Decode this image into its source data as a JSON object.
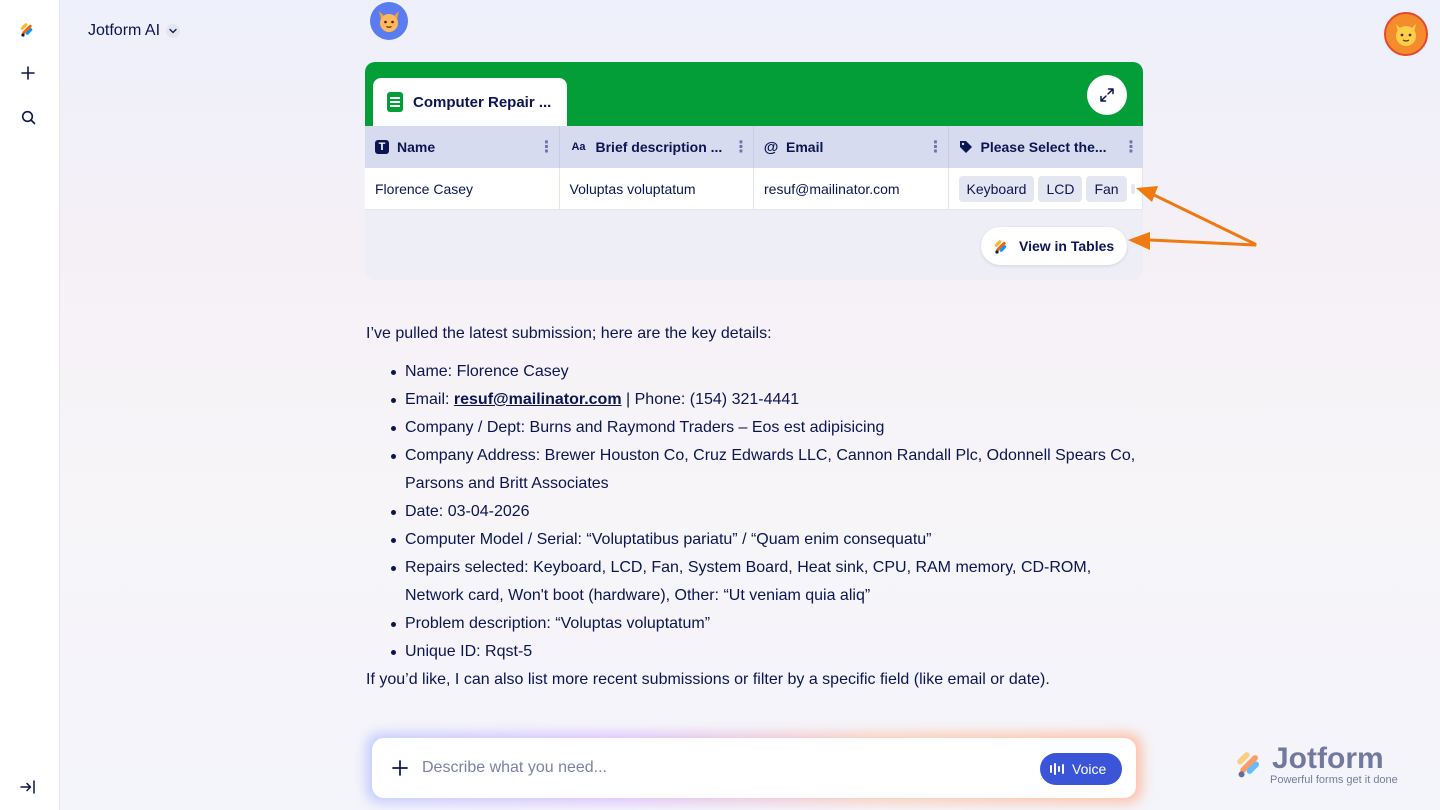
{
  "app": {
    "title": "Jotform AI"
  },
  "card": {
    "tab_title": "Computer Repair ...",
    "columns": [
      {
        "label": "Name",
        "icon": "text-type-icon"
      },
      {
        "label": "Brief description ...",
        "icon": "font-type-icon"
      },
      {
        "label": "Email",
        "icon": "at-icon"
      },
      {
        "label": "Please Select the...",
        "icon": "tag-icon"
      }
    ],
    "row": {
      "name": "Florence Casey",
      "description": "Voluptas voluptatum",
      "email": "resuf@mailinator.com",
      "chips": [
        "Keyboard",
        "LCD",
        "Fan"
      ]
    },
    "view_button": "View in Tables"
  },
  "message": {
    "intro": "I’ve pulled the latest submission; here are the key details:",
    "items": [
      {
        "label": "Name:",
        "text": "Florence Casey"
      },
      {
        "label": "Email:",
        "link": "resuf@mailinator.com",
        "text": "| Phone: (154) 321-4441"
      },
      {
        "label": "Company / Dept:",
        "text": "Burns and Raymond Traders – Eos est adipisicing"
      },
      {
        "label": "Company Address:",
        "text": "Brewer Houston Co, Cruz Edwards LLC, Cannon Randall Plc, Odonnell Spears Co, Parsons and Britt Associates"
      },
      {
        "label": "Date:",
        "text": "03-04-2026"
      },
      {
        "label": "Computer Model / Serial:",
        "text": "“Voluptatibus pariatu” / “Quam enim consequatu”"
      },
      {
        "label": "Repairs selected:",
        "text": "Keyboard, LCD, Fan, System Board, Heat sink, CPU, RAM memory, CD-ROM, Network card, Won't boot (hardware), Other: “Ut veniam quia aliq”"
      },
      {
        "label": "Problem description:",
        "text": "“Voluptas voluptatum”"
      },
      {
        "label": "Unique ID:",
        "text": "Rqst-5"
      }
    ],
    "outro": "If you’d like, I can also list more recent submissions or filter by a specific field (like email or date)."
  },
  "composer": {
    "placeholder": "Describe what you need...",
    "voice_label": "Voice"
  },
  "watermark": {
    "name": "Jotform",
    "tagline": "Powerful forms get it done"
  },
  "colors": {
    "header_green": "#049e38",
    "navy": "#0a1551",
    "voice_blue": "#3b55d9",
    "arrow_orange": "#f07a12"
  }
}
